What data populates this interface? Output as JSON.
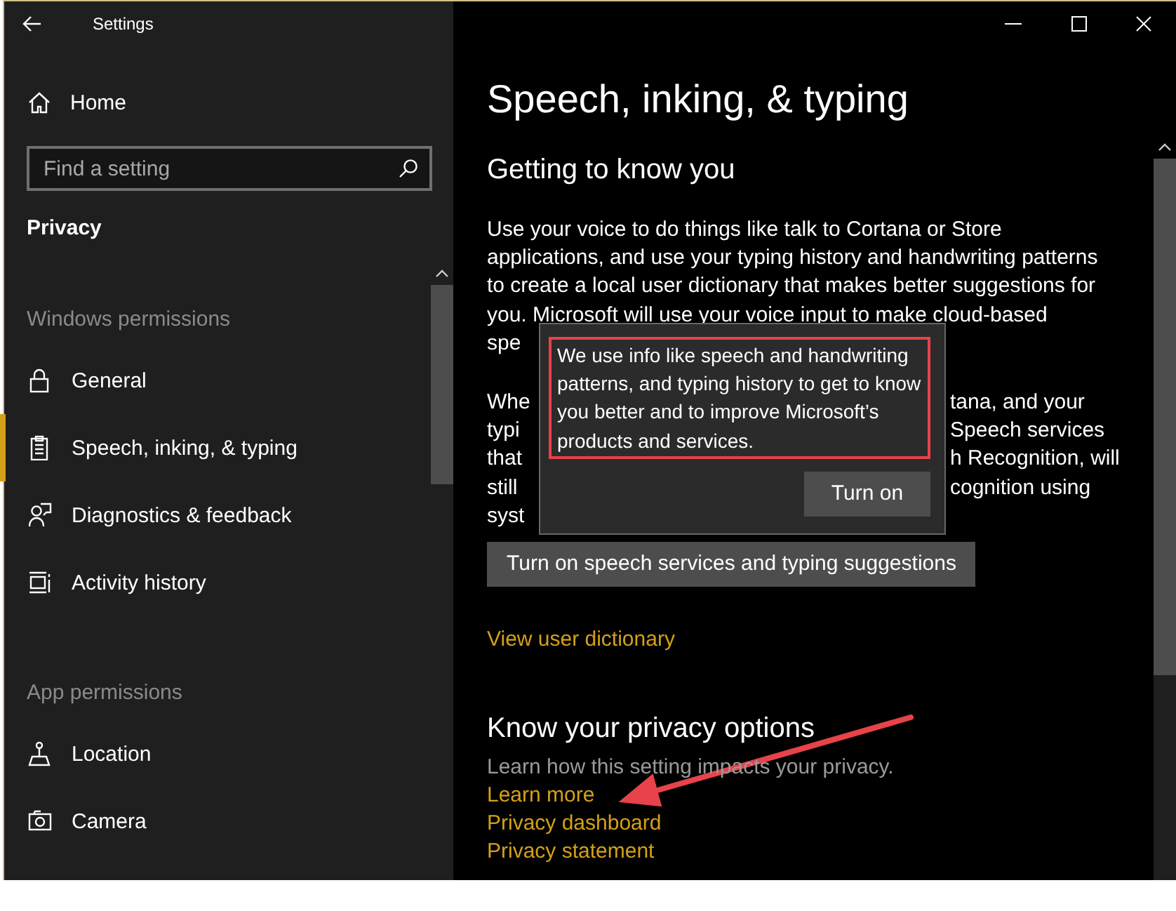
{
  "window": {
    "title": "Settings"
  },
  "sidebar": {
    "home": "Home",
    "search": {
      "placeholder": "Find a setting"
    },
    "section": "Privacy",
    "groups": [
      {
        "heading": "Windows permissions",
        "items": [
          {
            "label": "General",
            "kind": "lock",
            "selected": false
          },
          {
            "label": "Speech, inking, & typing",
            "kind": "clipboard",
            "selected": true
          },
          {
            "label": "Diagnostics & feedback",
            "kind": "person",
            "selected": false
          },
          {
            "label": "Activity history",
            "kind": "timeline",
            "selected": false
          }
        ]
      },
      {
        "heading": "App permissions",
        "items": [
          {
            "label": "Location",
            "kind": "pin",
            "selected": false
          },
          {
            "label": "Camera",
            "kind": "camera",
            "selected": false
          }
        ]
      }
    ]
  },
  "page": {
    "title": "Speech, inking, & typing",
    "getting_to_know_you": {
      "heading": "Getting to know you",
      "paragraph_1_lines": [
        "Use your voice to do things like talk to Cortana or Store",
        "applications, and use your typing history and handwriting patterns",
        "to create a local user dictionary that makes better suggestions for",
        "you. Microsoft will use your voice input to make cloud-based",
        "spe"
      ],
      "paragraph_2_lines": [
        {
          "left": "Whe",
          "right": "tana, and your"
        },
        {
          "left": "typi",
          "right": "Speech services"
        },
        {
          "left": "that",
          "right": "h Recognition, will"
        },
        {
          "left": "still",
          "right": "cognition using"
        },
        {
          "left": "syst"
        }
      ],
      "button": "Turn on speech services and typing suggestions",
      "link": "View user dictionary"
    },
    "privacy_options": {
      "heading": "Know your privacy options",
      "description": "Learn how this setting impacts your privacy.",
      "links": [
        "Learn more",
        "Privacy dashboard",
        "Privacy statement"
      ]
    }
  },
  "popup": {
    "message": "We use info like speech and handwriting patterns, and typing history to get to know you better and to improve Microsoft’s products and services.",
    "button": "Turn on"
  }
}
